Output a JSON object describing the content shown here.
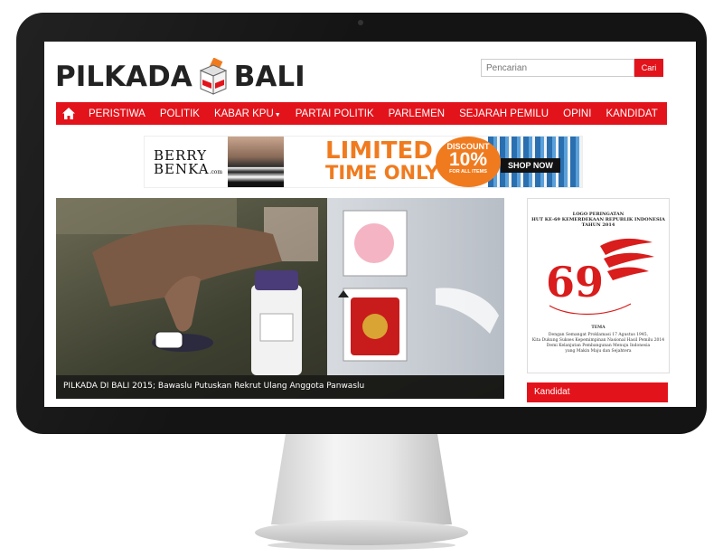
{
  "site": {
    "logo_left": "PILKADA",
    "logo_right": "BALI",
    "search_placeholder": "Pencarian",
    "search_button": "Cari"
  },
  "nav": {
    "home_icon": "home-icon",
    "items": [
      "PERISTIWA",
      "POLITIK",
      "KABAR KPU",
      "PARTAI POLITIK",
      "PARLEMEN",
      "SEJARAH PEMILU",
      "OPINI",
      "KANDIDAT"
    ]
  },
  "banner": {
    "brand_line1": "BERRY",
    "brand_line2": "BENKA",
    "brand_suffix": ".com",
    "headline_line1": "LIMITED",
    "headline_line2": "TIME ONLY",
    "discount_label": "DISCOUNT",
    "discount_value": "10%",
    "discount_sub": "FOR ALL ITEMS",
    "cta": "SHOP NOW"
  },
  "hero": {
    "caption": "PILKADA DI BALI 2015; Bawaslu Putuskan Rekrut Ulang Anggota Panwaslu"
  },
  "sidebar": {
    "poster_title_1": "LOGO PERINGATAN",
    "poster_title_2": "HUT KE-69 KEMERDEKAAN REPUBLIK INDONESIA",
    "poster_title_3": "TAHUN 2014",
    "poster_number": "69",
    "poster_tema": "TEMA",
    "poster_tema_1": "Dengan Semangat Proklamasi 17 Agustus 1945,",
    "poster_tema_2": "Kita Dukung Sukses Kepemimpinan Nasional Hasil Pemilu 2014",
    "poster_tema_3": "Demi Kelanjutan Pembangunan Menuju Indonesia",
    "poster_tema_4": "yang Makin Maju dan Sejahtera",
    "kandidat_title": "Kandidat"
  },
  "colors": {
    "brand_red": "#e3131b",
    "ad_orange": "#f07b1f",
    "bezel": "#141414"
  }
}
